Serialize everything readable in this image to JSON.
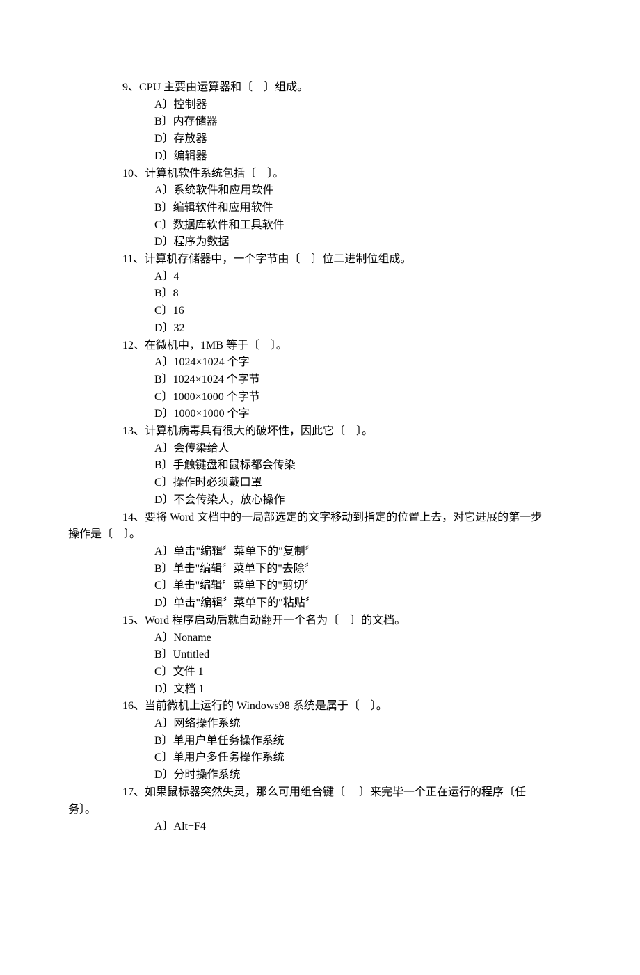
{
  "questions": {
    "q9": {
      "stem": "9、CPU 主要由运算器和〔　〕组成。",
      "A": "A〕控制器",
      "B": "B〕内存储器",
      "C": "D〕存放器",
      "D": "D〕编辑器"
    },
    "q10": {
      "stem": "10、计算机软件系统包括〔　〕。",
      "A": "A〕系统软件和应用软件",
      "B": "B〕编辑软件和应用软件",
      "C": "C〕数据库软件和工具软件",
      "D": "D〕程序为数据"
    },
    "q11": {
      "stem": "11、计算机存储器中，一个字节由〔　〕位二进制位组成。",
      "A": "A〕4",
      "B": "B〕8",
      "C": "C〕16",
      "D": "D〕32"
    },
    "q12": {
      "stem": "12、在微机中，1MB 等于〔　〕。",
      "A": "A〕1024×1024 个字",
      "B": "B〕1024×1024 个字节",
      "C": "C〕1000×1000 个字节",
      "D": "D〕1000×1000 个字"
    },
    "q13": {
      "stem": "13、计算机病毒具有很大的破坏性，因此它〔　〕。",
      "A": "A〕会传染给人",
      "B": "B〕手触键盘和鼠标都会传染",
      "C": "C〕操作时必须戴口罩",
      "D": "D〕不会传染人，放心操作"
    },
    "q14": {
      "stem_l1": "14、要将 Word 文档中的一局部选定的文字移动到指定的位置上去，对它进展的第一步",
      "stem_l2": "操作是〔　〕。",
      "A": "A〕单击\"编辑〞菜单下的\"复制〞",
      "B": "B〕单击\"编辑〞菜单下的\"去除〞",
      "C": "C〕单击\"编辑〞菜单下的\"剪切〞",
      "D": "D〕单击\"编辑〞菜单下的\"粘贴〞"
    },
    "q15": {
      "stem": "15、Word 程序启动后就自动翻开一个名为〔　〕的文档。",
      "A": "A〕Noname",
      "B": "B〕Untitled",
      "C": "C〕文件 1",
      "D": "D〕文档 1"
    },
    "q16": {
      "stem": "16、当前微机上运行的 Windows98 系统是属于〔　〕。",
      "A": "A〕网络操作系统",
      "B": "B〕单用户单任务操作系统",
      "C": "C〕单用户多任务操作系统",
      "D": "D〕分时操作系统"
    },
    "q17": {
      "stem_l1": "17、如果鼠标器突然失灵，那么可用组合键〔 　〕来完毕一个正在运行的程序〔任",
      "stem_l2": "务〕。",
      "A": "A〕Alt+F4"
    }
  }
}
